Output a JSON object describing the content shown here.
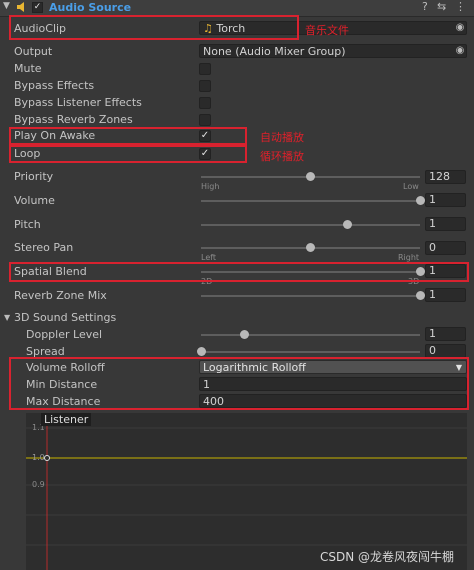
{
  "header": {
    "title": "Audio Source",
    "enabled": true
  },
  "audio_clip": {
    "label": "AudioClip",
    "value": "Torch",
    "annotation": "音乐文件"
  },
  "output": {
    "label": "Output",
    "value": "None (Audio Mixer Group)"
  },
  "mute": {
    "label": "Mute",
    "checked": false
  },
  "bypass_effects": {
    "label": "Bypass Effects",
    "checked": false
  },
  "bypass_listener_effects": {
    "label": "Bypass Listener Effects",
    "checked": false
  },
  "bypass_reverb_zones": {
    "label": "Bypass Reverb Zones",
    "checked": false
  },
  "play_on_awake": {
    "label": "Play On Awake",
    "checked": true,
    "check": "✓",
    "annotation": "自动播放"
  },
  "loop": {
    "label": "Loop",
    "checked": true,
    "check": "✓",
    "annotation": "循环播放"
  },
  "priority": {
    "label": "Priority",
    "value": "128",
    "fraction": 0.5,
    "min_label": "High",
    "max_label": "Low"
  },
  "volume": {
    "label": "Volume",
    "value": "1",
    "fraction": 1.0
  },
  "pitch": {
    "label": "Pitch",
    "value": "1",
    "fraction": 0.667
  },
  "stereo_pan": {
    "label": "Stereo Pan",
    "value": "0",
    "fraction": 0.5,
    "min_label": "Left",
    "max_label": "Right"
  },
  "spatial_blend": {
    "label": "Spatial Blend",
    "value": "1",
    "fraction": 1.0,
    "min_label": "2D",
    "max_label": "3D"
  },
  "reverb_zone_mix": {
    "label": "Reverb Zone Mix",
    "value": "1",
    "fraction": 1.0
  },
  "sound_3d": {
    "label": "3D Sound Settings",
    "doppler_level": {
      "label": "Doppler Level",
      "value": "1",
      "fraction": 0.2
    },
    "spread": {
      "label": "Spread",
      "value": "0",
      "fraction": 0.0
    },
    "volume_rolloff": {
      "label": "Volume Rolloff",
      "value": "Logarithmic Rolloff"
    },
    "min_distance": {
      "label": "Min Distance",
      "value": "1"
    },
    "max_distance": {
      "label": "Max Distance",
      "value": "400"
    }
  },
  "graph": {
    "listener_label": "Listener",
    "y_ticks": [
      "1.1",
      "1.0",
      "0.9"
    ]
  },
  "watermark": "CSDN @龙卷风夜闯牛棚",
  "colors": {
    "accent": "#4a9ee8",
    "highlight": "#d8222f",
    "annotation": "#e0202a",
    "curve": "#c8b400"
  }
}
